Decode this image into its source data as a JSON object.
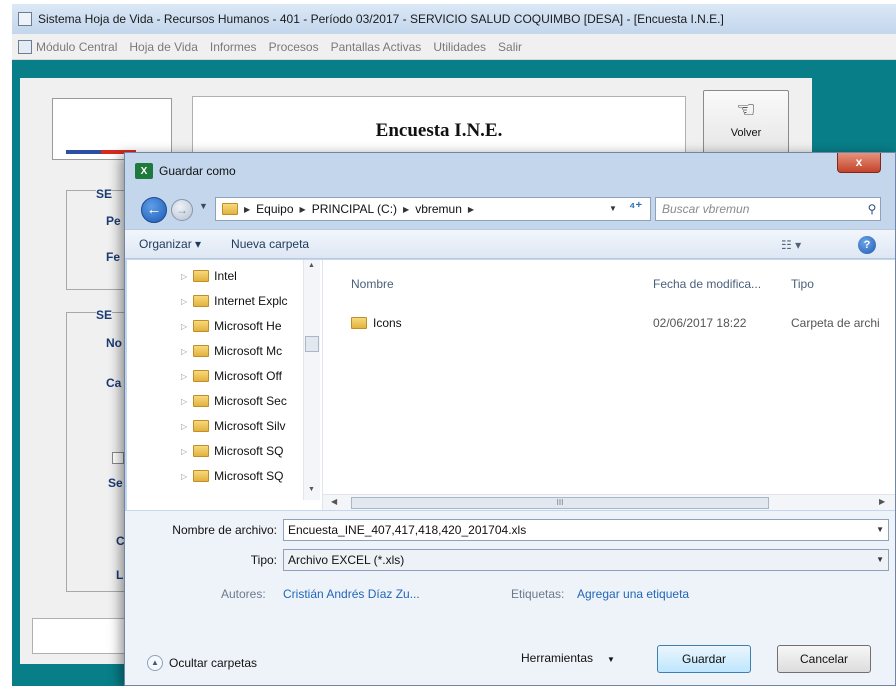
{
  "app": {
    "title": "Sistema Hoja de Vida - Recursos Humanos - 401 - Período 03/2017 - SERVICIO SALUD COQUIMBO [DESA] - [Encuesta I.N.E.]",
    "menu": [
      "Módulo Central",
      "Hoja de Vida",
      "Informes",
      "Procesos",
      "Pantallas Activas",
      "Utilidades",
      "Salir"
    ],
    "form_title": "Encuesta I.N.E.",
    "volver_label": "Volver",
    "background_color": "#087e88"
  },
  "form_fragments": {
    "g1_label": "SE",
    "pe": "Pe",
    "fe": "Fe",
    "g2_label": "SE",
    "no": "No",
    "ca": "Ca",
    "se": "Se",
    "c": "C",
    "l": "L"
  },
  "dialog": {
    "title": "Guardar como",
    "close_label": "x",
    "path": [
      "Equipo",
      "PRINCIPAL (C:)",
      "vbremun"
    ],
    "search_placeholder": "Buscar vbremun",
    "toolbar": {
      "organize": "Organizar",
      "new_folder": "Nueva carpeta"
    },
    "tree_items": [
      "Intel",
      "Internet Explc",
      "Microsoft He",
      "Microsoft Mc",
      "Microsoft Off",
      "Microsoft Sec",
      "Microsoft Silv",
      "Microsoft SQ",
      "Microsoft SQ"
    ],
    "columns": {
      "name": "Nombre",
      "date": "Fecha de modifica...",
      "type": "Tipo"
    },
    "files": [
      {
        "name": "Icons",
        "date": "02/06/2017 18:22",
        "type": "Carpeta de archi"
      }
    ],
    "filename_label": "Nombre de archivo:",
    "filename_value": "Encuesta_INE_407,417,418,420_201704.xls",
    "type_label": "Tipo:",
    "type_value": "Archivo EXCEL (*.xls)",
    "authors_label": "Autores:",
    "authors_value": "Cristián Andrés Díaz Zu...",
    "tags_label": "Etiquetas:",
    "tags_value": "Agregar una etiqueta",
    "hide_folders": "Ocultar carpetas",
    "tools": "Herramientas",
    "save": "Guardar",
    "cancel": "Cancelar",
    "scroll_grip": "III"
  }
}
